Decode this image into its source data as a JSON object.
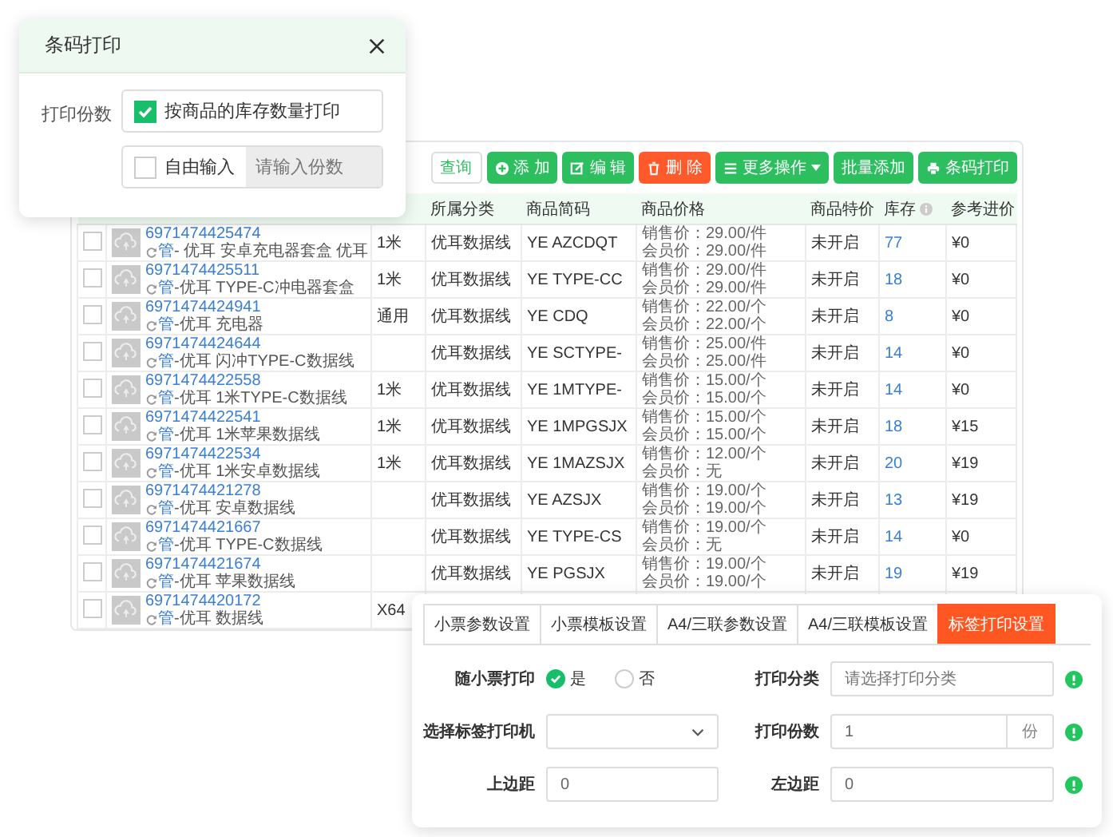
{
  "barcode_dialog": {
    "title": "条码打印",
    "label": "打印份数",
    "options": [
      {
        "kind": "checkbox",
        "label": "按商品的库存数量打印",
        "checked": true
      },
      {
        "kind": "checkbox_input",
        "label": "自由输入",
        "checked": false,
        "placeholder": "请输入份数"
      }
    ]
  },
  "toolbar": {
    "buttons": [
      {
        "label": "查询",
        "kind": "search"
      },
      {
        "label": "添 加",
        "kind": "add"
      },
      {
        "label": "编 辑",
        "kind": "edit"
      },
      {
        "label": "删 除",
        "kind": "delete"
      },
      {
        "label": "更多操作",
        "kind": "more",
        "caret": true
      },
      {
        "label": "批量添加",
        "kind": "batch"
      },
      {
        "label": "条码打印",
        "kind": "print"
      }
    ]
  },
  "table": {
    "columns": [
      {
        "label": "所属分类"
      },
      {
        "label": "商品简码"
      },
      {
        "label": "商品价格"
      },
      {
        "label": "商品特价"
      },
      {
        "label": "库存",
        "info": true
      },
      {
        "label": "参考进价"
      }
    ],
    "rows": [
      {
        "checked": false,
        "barcode": "6971474425474",
        "tag": "管",
        "title": "- 优耳 安卓充电器套盒 优耳",
        "spec": "1米",
        "category": "优耳数据线",
        "code": "YE AZCDQT",
        "sale": "销售价：29.00/件",
        "member": "会员价：29.00/件",
        "special": "未开启",
        "stock": "77",
        "cost": "¥0"
      },
      {
        "checked": false,
        "barcode": "6971474425511",
        "tag": "管",
        "title": "-优耳 TYPE-C冲电器套盒",
        "spec": "1米",
        "category": "优耳数据线",
        "code": "YE TYPE-CC",
        "sale": "销售价：29.00/件",
        "member": "会员价：29.00/件",
        "special": "未开启",
        "stock": "18",
        "cost": "¥0"
      },
      {
        "checked": false,
        "barcode": "6971474424941",
        "tag": "管",
        "title": "-优耳 充电器",
        "spec": "通用",
        "category": "优耳数据线",
        "code": "YE CDQ",
        "sale": "销售价：22.00/个",
        "member": "会员价：22.00/个",
        "special": "未开启",
        "stock": "8",
        "cost": "¥0"
      },
      {
        "checked": false,
        "barcode": "6971474424644",
        "tag": "管",
        "title": "-优耳 闪冲TYPE-C数据线",
        "category": "优耳数据线",
        "code": "YE SCTYPE-",
        "sale": "销售价：25.00/件",
        "member": "会员价：25.00/件",
        "special": "未开启",
        "stock": "14",
        "cost": "¥0"
      },
      {
        "checked": false,
        "barcode": "6971474422558",
        "tag": "管",
        "title": "-优耳 1米TYPE-C数据线",
        "spec": "1米",
        "category": "优耳数据线",
        "code": "YE 1MTYPE-",
        "sale": "销售价：15.00/个",
        "member": "会员价：15.00/个",
        "special": "未开启",
        "stock": "14",
        "cost": "¥0"
      },
      {
        "checked": false,
        "barcode": "6971474422541",
        "tag": "管",
        "title": "-优耳 1米苹果数据线",
        "spec": "1米",
        "category": "优耳数据线",
        "code": "YE 1MPGSJX",
        "sale": "销售价：15.00/个",
        "member": "会员价：15.00/个",
        "special": "未开启",
        "stock": "18",
        "cost": "¥15"
      },
      {
        "checked": false,
        "barcode": "6971474422534",
        "tag": "管",
        "title": "-优耳 1米安卓数据线",
        "spec": "1米",
        "category": "优耳数据线",
        "code": "YE 1MAZSJX",
        "sale": "销售价：12.00/个",
        "member": "会员价：无",
        "special": "未开启",
        "stock": "20",
        "cost": "¥19"
      },
      {
        "checked": false,
        "barcode": "6971474421278",
        "tag": "管",
        "title": "-优耳 安卓数据线",
        "category": "优耳数据线",
        "code": "YE AZSJX",
        "sale": "销售价：19.00/个",
        "member": "会员价：19.00/个",
        "special": "未开启",
        "stock": "13",
        "cost": "¥19"
      },
      {
        "checked": false,
        "barcode": "6971474421667",
        "tag": "管",
        "title": "-优耳 TYPE-C数据线",
        "category": "优耳数据线",
        "code": "YE TYPE-CS",
        "sale": "销售价：19.00/个",
        "member": "会员价：无",
        "special": "未开启",
        "stock": "14",
        "cost": "¥0"
      },
      {
        "checked": false,
        "barcode": "6971474421674",
        "tag": "管",
        "title": "-优耳 苹果数据线",
        "category": "优耳数据线",
        "code": "YE PGSJX",
        "sale": "销售价：19.00/个",
        "member": "会员价：19.00/个",
        "special": "未开启",
        "stock": "19",
        "cost": "¥19"
      },
      {
        "checked": false,
        "barcode": "6971474420172",
        "tag": "管",
        "title": "-优耳 数据线",
        "spec": "X64"
      }
    ]
  },
  "settings_panel": {
    "tabs": [
      {
        "label": "小票参数设置",
        "selected": false
      },
      {
        "label": "小票模板设置",
        "selected": false
      },
      {
        "label": "A4/三联参数设置",
        "selected": false
      },
      {
        "label": "A4/三联模板设置",
        "selected": false
      },
      {
        "label": "标签打印设置",
        "selected": true
      }
    ],
    "fields": [
      {
        "label": "随小票打印",
        "kind": "radio",
        "options": [
          {
            "label": "是",
            "selected": true
          },
          {
            "label": "否",
            "selected": false
          }
        ]
      },
      {
        "label": "打印分类",
        "kind": "input",
        "placeholder": "请选择打印分类"
      },
      {
        "label": "选择标签打印机",
        "kind": "select"
      },
      {
        "label": "打印份数",
        "kind": "unit_input",
        "value": "1",
        "unit": "份"
      },
      {
        "label": "上边距",
        "kind": "input",
        "value": "0"
      },
      {
        "label": "左边距",
        "kind": "input",
        "value": "0"
      }
    ]
  }
}
